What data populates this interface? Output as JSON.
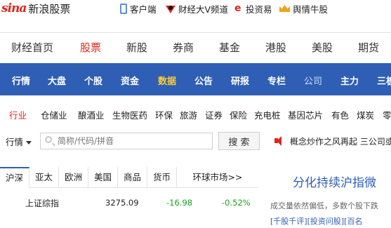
{
  "header": {
    "logo_mark": "sina",
    "logo_text": "新浪股票",
    "links": [
      {
        "label": "客户端",
        "icon": "phone-icon"
      },
      {
        "label": "财经大V频道",
        "icon": "weibo-icon"
      },
      {
        "label": "投资易",
        "icon": "touziyi-icon"
      },
      {
        "label": "舆情牛股",
        "icon": "crown-icon"
      }
    ]
  },
  "main_nav": {
    "items": [
      "财经首页",
      "股票",
      "新股",
      "券商",
      "基金",
      "港股",
      "美股",
      "期货"
    ],
    "active": "股票"
  },
  "sub_nav": {
    "items": [
      "行情",
      "大盘",
      "个股",
      "资金",
      "数据",
      "公告",
      "研报",
      "专栏",
      "公司",
      "主力",
      "三板"
    ],
    "highlighted": "数据"
  },
  "categories": {
    "items": [
      "行业",
      "仓储业",
      "酿酒业",
      "生物医药",
      "环保",
      "旅游",
      "证券",
      "保险",
      "充电桩",
      "基因芯片",
      "有色",
      "煤炭",
      "零"
    ],
    "active": "行业"
  },
  "search": {
    "type_label": "行情",
    "placeholder": "简称/代码/拼音",
    "button_label": "搜 索",
    "ticker_text": "概念炒作之风再起  三公司或"
  },
  "market_tabs": {
    "items": [
      "沪深",
      "亚太",
      "欧洲",
      "美国",
      "商品",
      "货币",
      "环球市场>>"
    ],
    "active": "沪深"
  },
  "quote": {
    "name": "上证综指",
    "price": "3275.09",
    "change": "-16.98",
    "change_pct": "-0.52%"
  },
  "news": {
    "headline": "分化持续沪指微",
    "summary": "成交量依然偏低，多数个股下跌",
    "links": "[千股千评][投资问股][百名"
  },
  "colors": {
    "brand_red": "#e1251b",
    "nav_blue": "#2f5eb5",
    "highlight_yellow": "#ffcc33",
    "down_green": "#18a318"
  }
}
